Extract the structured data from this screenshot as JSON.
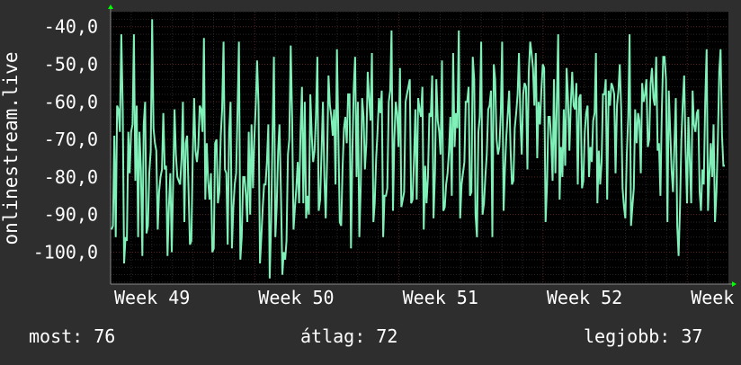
{
  "chart_data": {
    "type": "line",
    "ylabel": "onlinestream.live",
    "ylim": [
      -108.5,
      -36
    ],
    "yticks": [
      -40,
      -50,
      -60,
      -70,
      -80,
      -90,
      -100
    ],
    "ytick_labels": [
      "-40,0",
      "-50,0",
      "-60,0",
      "-70,0",
      "-80,0",
      "-90,0",
      "-100,0"
    ],
    "xlim": [
      0,
      60
    ],
    "xticks": [
      0,
      14,
      28,
      42,
      56
    ],
    "xtick_labels": [
      "Week 49",
      "Week 50",
      "Week 51",
      "Week 52",
      "Week"
    ],
    "grid": true,
    "series": [
      {
        "values": [
          -94,
          -93,
          -69,
          -96,
          -61,
          -62,
          -68,
          -42,
          -62,
          -103,
          -96,
          -97,
          -68,
          -79,
          -68,
          -66,
          -42,
          -81,
          -61,
          -96,
          -68,
          -78,
          -101,
          -66,
          -60,
          -95,
          -93,
          -79,
          -73,
          -38,
          -67,
          -71,
          -73,
          -94,
          -84,
          -80,
          -78,
          -63,
          -78,
          -77,
          -101,
          -88,
          -79,
          -100,
          -82,
          -62,
          -74,
          -80,
          -81,
          -82,
          -75,
          -60,
          -92,
          -71,
          -69,
          -83,
          -98,
          -97,
          -75,
          -59,
          -73,
          -76,
          -72,
          -61,
          -62,
          -68,
          -43,
          -86,
          -71,
          -81,
          -86,
          -79,
          -100,
          -99,
          -71,
          -70,
          -87,
          -84,
          -69,
          -62,
          -44,
          -78,
          -79,
          -98,
          -68,
          -60,
          -99,
          -88,
          -82,
          -79,
          -63,
          -44,
          -102,
          -96,
          -80,
          -80,
          -85,
          -92,
          -68,
          -90,
          -66,
          -83,
          -70,
          -61,
          -49,
          -61,
          -103,
          -96,
          -88,
          -82,
          -82,
          -76,
          -66,
          -107,
          -92,
          -68,
          -48,
          -96,
          -88,
          -73,
          -66,
          -84,
          -106,
          -100,
          -102,
          -97,
          -74,
          -70,
          -45,
          -65,
          -94,
          -88,
          -83,
          -76,
          -87,
          -68,
          -56,
          -87,
          -60,
          -91,
          -85,
          -90,
          -58,
          -69,
          -76,
          -73,
          -64,
          -48,
          -89,
          -86,
          -73,
          -60,
          -80,
          -91,
          -75,
          -53,
          -61,
          -64,
          -69,
          -62,
          -82,
          -46,
          -68,
          -92,
          -93,
          -78,
          -67,
          -64,
          -71,
          -58,
          -58,
          -99,
          -74,
          -56,
          -48,
          -80,
          -60,
          -96,
          -82,
          -59,
          -64,
          -78,
          -71,
          -52,
          -59,
          -65,
          -47,
          -92,
          -87,
          -75,
          -68,
          -59,
          -63,
          -57,
          -96,
          -85,
          -85,
          -83,
          -60,
          -57,
          -41,
          -89,
          -70,
          -60,
          -63,
          -72,
          -51,
          -88,
          -86,
          -84,
          -60,
          -58,
          -56,
          -54,
          -87,
          -86,
          -76,
          -62,
          -86,
          -59,
          -62,
          -64,
          -56,
          -94,
          -77,
          -87,
          -80,
          -63,
          -64,
          -53,
          -91,
          -79,
          -54,
          -65,
          -68,
          -74,
          -49,
          -89,
          -88,
          -82,
          -79,
          -73,
          -64,
          -85,
          -47,
          -72,
          -63,
          -67,
          -41,
          -91,
          -82,
          -79,
          -76,
          -60,
          -60,
          -56,
          -85,
          -84,
          -48,
          -54,
          -90,
          -96,
          -68,
          -64,
          -44,
          -90,
          -87,
          -80,
          -74,
          -62,
          -61,
          -57,
          -96,
          -50,
          -54,
          -70,
          -74,
          -72,
          -63,
          -44,
          -89,
          -78,
          -69,
          -63,
          -57,
          -73,
          -82,
          -81,
          -67,
          -63,
          -58,
          -47,
          -65,
          -74,
          -58,
          -55,
          -56,
          -78,
          -52,
          -44,
          -47,
          -51,
          -61,
          -47,
          -75,
          -60,
          -66,
          -57,
          -50,
          -51,
          -92,
          -82,
          -64,
          -64,
          -70,
          -81,
          -54,
          -79,
          -60,
          -42,
          -86,
          -72,
          -80,
          -62,
          -77,
          -51,
          -59,
          -73,
          -61,
          -52,
          -61,
          -62,
          -55,
          -82,
          -59,
          -58,
          -83,
          -81,
          -68,
          -63,
          -61,
          -80,
          -72,
          -76,
          -65,
          -63,
          -47,
          -87,
          -73,
          -82,
          -76,
          -58,
          -58,
          -54,
          -86,
          -57,
          -61,
          -55,
          -56,
          -58,
          -79,
          -61,
          -57,
          -50,
          -62,
          -83,
          -88,
          -91,
          -74,
          -64,
          -42,
          -93,
          -88,
          -83,
          -62,
          -71,
          -63,
          -65,
          -79,
          -55,
          -60,
          -58,
          -54,
          -72,
          -70,
          -55,
          -51,
          -59,
          -61,
          -48,
          -73,
          -71,
          -85,
          -63,
          -48,
          -48,
          -54,
          -92,
          -57,
          -68,
          -78,
          -84,
          -72,
          -59,
          -93,
          -101,
          -88,
          -70,
          -60,
          -53,
          -73,
          -87,
          -64,
          -76,
          -87,
          -57,
          -66,
          -68,
          -63,
          -62,
          -84,
          -89,
          -78,
          -82,
          -60,
          -46,
          -89,
          -79,
          -71,
          -80,
          -66,
          -92,
          -84,
          -71,
          -52,
          -46,
          -69,
          -77,
          -77
        ],
        "color": "#7ff0b8"
      }
    ]
  },
  "stats": {
    "current": "most: 76",
    "average": "átlag: 72",
    "best": "legjobb: 37"
  },
  "colors": {
    "background": "#2e2e2e",
    "plot_background": "#000000",
    "line": "#7ff0b8",
    "axis_arrow": "#00ff00",
    "grid_major": "#5a2424",
    "grid_minor": "#262626"
  }
}
